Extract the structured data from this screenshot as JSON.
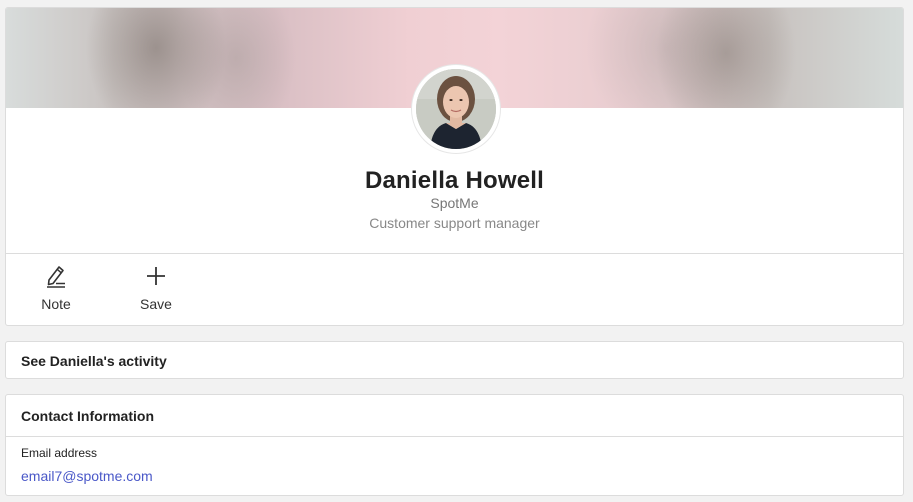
{
  "profile": {
    "name": "Daniella Howell",
    "company": "SpotMe",
    "role": "Customer support manager",
    "avatar_alt": "Profile photo of Daniella Howell"
  },
  "actions": [
    {
      "label": "Note",
      "icon": "note-edit-icon"
    },
    {
      "label": "Save",
      "icon": "plus-icon"
    }
  ],
  "activity": {
    "title": "See Daniella's activity"
  },
  "contact": {
    "title": "Contact Information",
    "email_label": "Email address",
    "email_value": "email7@spotme.com"
  },
  "colors": {
    "link": "#4a58c8",
    "border": "#dcdcdc",
    "background": "#f2f2f2"
  }
}
